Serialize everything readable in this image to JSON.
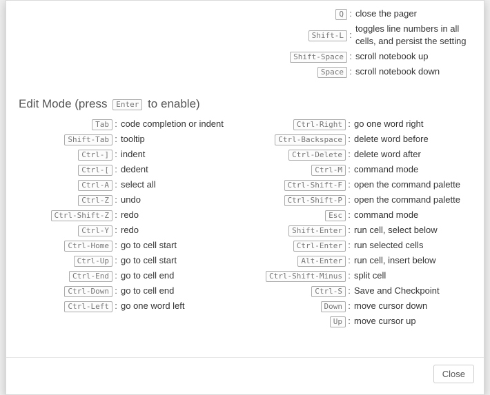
{
  "top_right": [
    {
      "key": "Q",
      "desc": "close the pager"
    },
    {
      "key": "Shift-L",
      "desc": "toggles line numbers in all cells, and persist the setting"
    },
    {
      "key": "Shift-Space",
      "desc": "scroll notebook up"
    },
    {
      "key": "Space",
      "desc": "scroll notebook down"
    }
  ],
  "edit_title_pre": "Edit Mode (press ",
  "edit_title_kbd": "Enter",
  "edit_title_post": " to enable)",
  "edit_left": [
    {
      "key": "Tab",
      "desc": "code completion or indent"
    },
    {
      "key": "Shift-Tab",
      "desc": "tooltip"
    },
    {
      "key": "Ctrl-]",
      "desc": "indent"
    },
    {
      "key": "Ctrl-[",
      "desc": "dedent"
    },
    {
      "key": "Ctrl-A",
      "desc": "select all"
    },
    {
      "key": "Ctrl-Z",
      "desc": "undo"
    },
    {
      "key": "Ctrl-Shift-Z",
      "desc": "redo"
    },
    {
      "key": "Ctrl-Y",
      "desc": "redo"
    },
    {
      "key": "Ctrl-Home",
      "desc": "go to cell start"
    },
    {
      "key": "Ctrl-Up",
      "desc": "go to cell start"
    },
    {
      "key": "Ctrl-End",
      "desc": "go to cell end"
    },
    {
      "key": "Ctrl-Down",
      "desc": "go to cell end"
    },
    {
      "key": "Ctrl-Left",
      "desc": "go one word left"
    }
  ],
  "edit_right": [
    {
      "key": "Ctrl-Right",
      "desc": "go one word right"
    },
    {
      "key": "Ctrl-Backspace",
      "desc": "delete word before"
    },
    {
      "key": "Ctrl-Delete",
      "desc": "delete word after"
    },
    {
      "key": "Ctrl-M",
      "desc": "command mode"
    },
    {
      "key": "Ctrl-Shift-F",
      "desc": "open the command palette"
    },
    {
      "key": "Ctrl-Shift-P",
      "desc": "open the command palette"
    },
    {
      "key": "Esc",
      "desc": "command mode"
    },
    {
      "key": "Shift-Enter",
      "desc": "run cell, select below"
    },
    {
      "key": "Ctrl-Enter",
      "desc": "run selected cells"
    },
    {
      "key": "Alt-Enter",
      "desc": "run cell, insert below"
    },
    {
      "key": "Ctrl-Shift-Minus",
      "desc": "split cell"
    },
    {
      "key": "Ctrl-S",
      "desc": "Save and Checkpoint"
    },
    {
      "key": "Down",
      "desc": "move cursor down"
    },
    {
      "key": "Up",
      "desc": "move cursor up"
    }
  ],
  "close_label": "Close"
}
